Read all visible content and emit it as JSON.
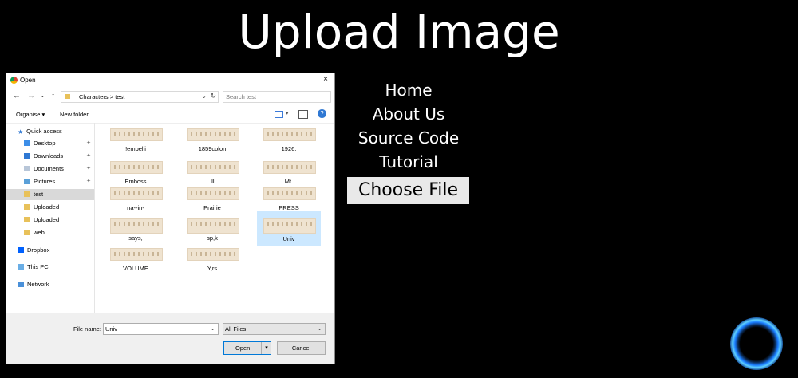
{
  "page": {
    "title": "Upload Image",
    "nav": [
      "Home",
      "About Us",
      "Source Code",
      "Tutorial"
    ],
    "choose_file": "Choose File"
  },
  "dialog": {
    "title": "Open",
    "close": "×",
    "back": "←",
    "forward": "→",
    "dropdown": "⌄",
    "up": "↑",
    "path": "Characters  >  test",
    "refresh": "↻",
    "search_placeholder": "Search test",
    "organise": "Organise ▾",
    "new_folder": "New folder",
    "view_dropdown": "▾",
    "help": "?",
    "pin": "✦",
    "sidebar": [
      "Quick access",
      "Desktop",
      "Downloads",
      "Documents",
      "Pictures",
      "test",
      "Uploaded",
      "Uploaded",
      "web",
      "Dropbox",
      "This PC",
      "Network"
    ],
    "files": [
      "!embelli",
      "1859colon",
      "1926.",
      "Emboss",
      "lll",
      "Mt.",
      "na--in-",
      "Prairie",
      "PRESS",
      "says,",
      "sp,k",
      "Univ",
      "VOLUME",
      "Y,rs"
    ],
    "file_name_label": "File name:",
    "file_name_value": "Univ",
    "file_type": "All Files",
    "select_arrow": "⌄",
    "open": "Open",
    "open_arrow": "▾",
    "cancel": "Cancel"
  }
}
